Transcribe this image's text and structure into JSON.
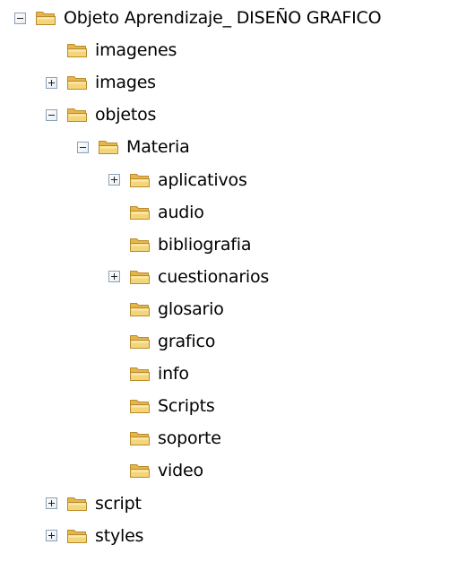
{
  "tree": [
    {
      "label": "Objeto Aprendizaje_ DISEÑO GRAFICO",
      "level": 0,
      "expander": "expanded"
    },
    {
      "label": "imagenes",
      "level": 1,
      "expander": "none"
    },
    {
      "label": "images",
      "level": 1,
      "expander": "collapsed"
    },
    {
      "label": "objetos",
      "level": 1,
      "expander": "expanded"
    },
    {
      "label": "Materia",
      "level": 2,
      "expander": "expanded"
    },
    {
      "label": "aplicativos",
      "level": 3,
      "expander": "collapsed"
    },
    {
      "label": "audio",
      "level": 3,
      "expander": "none"
    },
    {
      "label": "bibliografia",
      "level": 3,
      "expander": "none"
    },
    {
      "label": "cuestionarios",
      "level": 3,
      "expander": "collapsed"
    },
    {
      "label": "glosario",
      "level": 3,
      "expander": "none"
    },
    {
      "label": "grafico",
      "level": 3,
      "expander": "none"
    },
    {
      "label": "info",
      "level": 3,
      "expander": "none"
    },
    {
      "label": "Scripts",
      "level": 3,
      "expander": "none"
    },
    {
      "label": "soporte",
      "level": 3,
      "expander": "none"
    },
    {
      "label": "video",
      "level": 3,
      "expander": "none"
    },
    {
      "label": "script",
      "level": 1,
      "expander": "collapsed"
    },
    {
      "label": "styles",
      "level": 1,
      "expander": "collapsed"
    }
  ],
  "icons": {
    "folder": "folder-icon",
    "expand": "expand-icon",
    "collapse": "collapse-icon"
  },
  "colors": {
    "folder_front": "#f4d67a",
    "folder_back": "#e7b64b",
    "folder_outline": "#b98a2c",
    "expander_border": "#8c9fb5"
  }
}
